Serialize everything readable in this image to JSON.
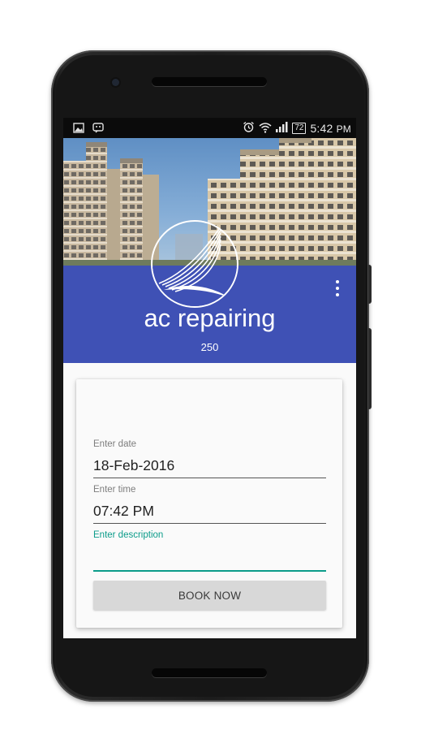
{
  "status_bar": {
    "time": "5:42",
    "ampm": "PM",
    "battery": "72",
    "left_icons": [
      "image-icon",
      "app-notification-icon"
    ],
    "right_icons": [
      "alarm-icon",
      "wifi-icon",
      "signal-icon",
      "battery-icon"
    ]
  },
  "header": {
    "title": "ac repairing",
    "subtitle": "250",
    "menu_icon": "more-vert-icon"
  },
  "form": {
    "date": {
      "label": "Enter date",
      "value": "18-Feb-2016"
    },
    "time": {
      "label": "Enter time",
      "value": "07:42 PM"
    },
    "description": {
      "label": "Enter description",
      "value": ""
    },
    "book_label": "BOOK NOW"
  },
  "colors": {
    "primary": "#3f51b5",
    "accent": "#0b9c8a",
    "button": "#d8d8d8"
  }
}
